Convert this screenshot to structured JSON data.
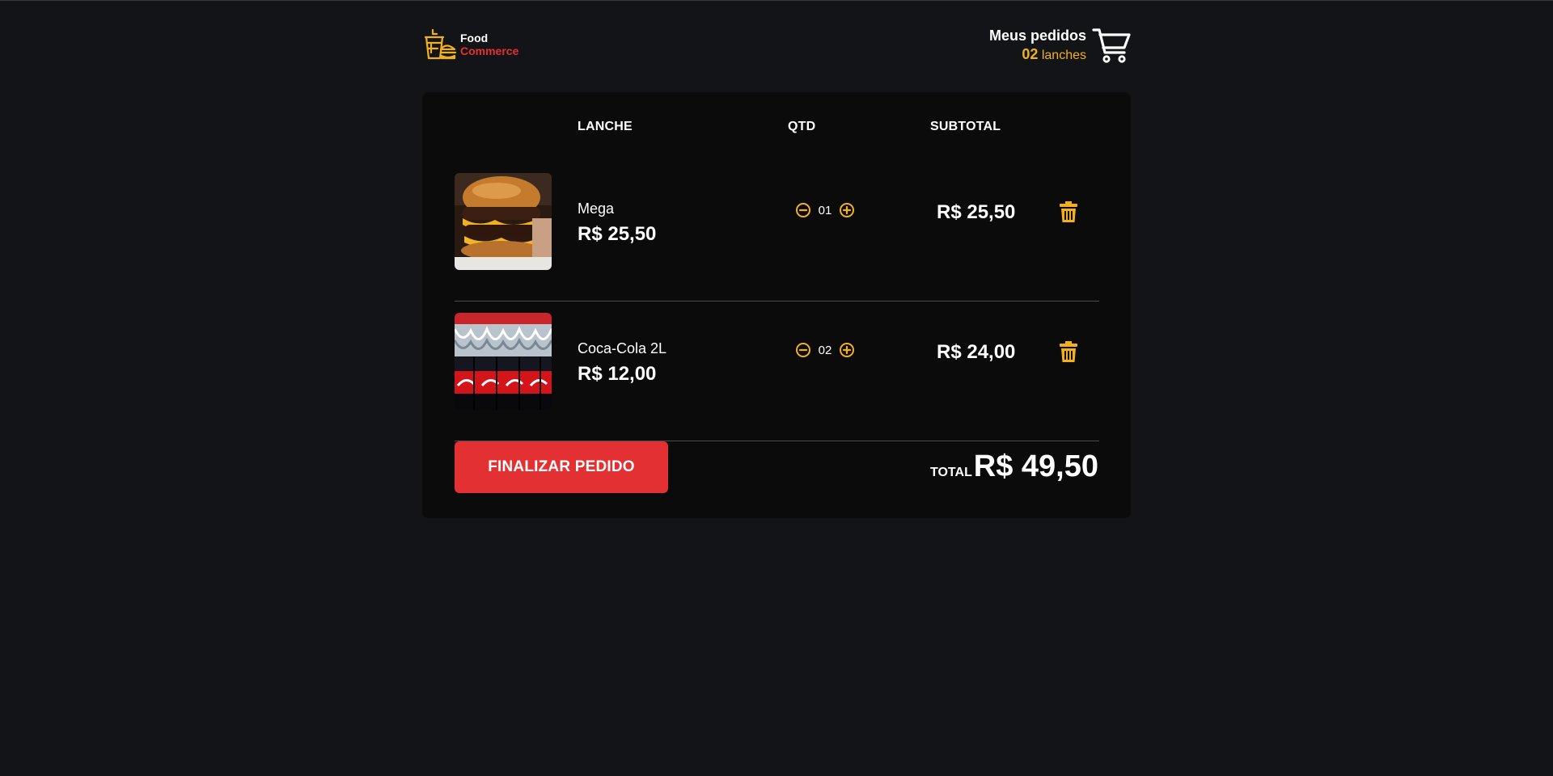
{
  "brand": {
    "name_top": "Food",
    "name_bottom": "Commerce",
    "accent_color": "#f2b01e",
    "brand_red": "#e33133",
    "icon": "food-drink-burger-logo"
  },
  "orders": {
    "title": "Meus pedidos",
    "count": "02",
    "unit": "lanches",
    "icon": "cart-icon"
  },
  "table": {
    "headers": {
      "item": "LANCHE",
      "qty": "QTD",
      "subtotal": "SUBTOTAL"
    },
    "rows": [
      {
        "name": "Mega",
        "price": "R$ 25,50",
        "qty": "01",
        "subtotal": "R$ 25,50",
        "image": "burger-photo"
      },
      {
        "name": "Coca-Cola 2L",
        "price": "R$ 12,00",
        "qty": "02",
        "subtotal": "R$ 24,00",
        "image": "coca-cola-bottles-photo"
      }
    ]
  },
  "footer": {
    "finish_label": "FINALIZAR PEDIDO",
    "total_label": "TOTAL",
    "total_value": "R$ 49,50"
  }
}
